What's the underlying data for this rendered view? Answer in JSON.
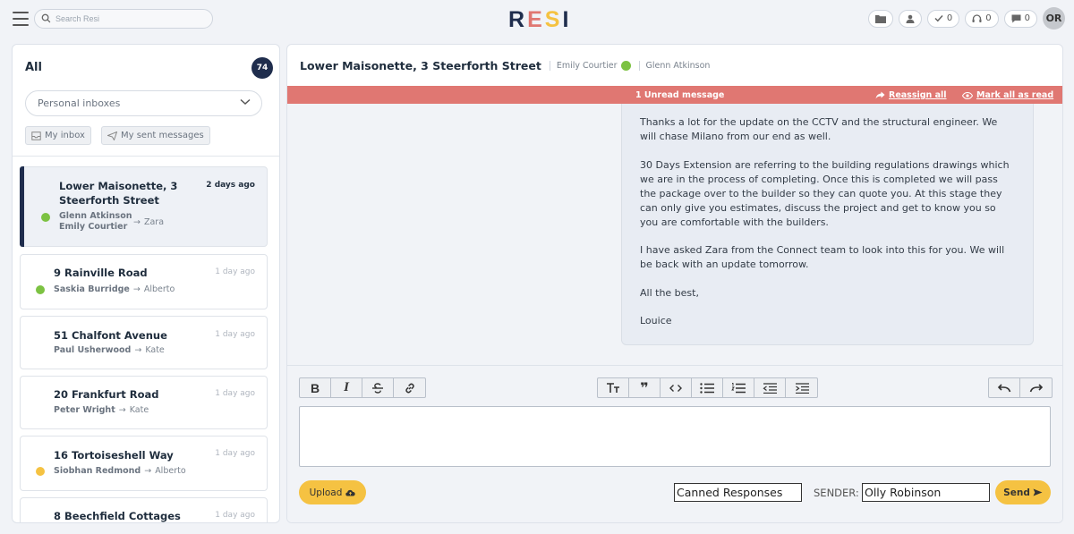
{
  "header": {
    "search_placeholder": "Search Resi",
    "logo_letters": [
      "R",
      "E",
      "S",
      "I"
    ],
    "logo_colors": [
      "#1f2d4d",
      "#e07772",
      "#f5c242",
      "#1f2d4d"
    ],
    "tasks_count": "0",
    "support_count": "0",
    "messages_count": "0",
    "avatar_initials": "OR"
  },
  "sidebar": {
    "title": "All",
    "count": "74",
    "inbox_select": "Personal inboxes",
    "my_inbox": "My inbox",
    "my_sent": "My sent messages",
    "conversations": [
      {
        "title_line1": "Lower Maisonette, 3",
        "title_line2": "Steerforth Street",
        "time": "2 days ago",
        "from1": "Glenn Atkinson",
        "from2": "Emily Courtier",
        "to": "Zara",
        "mood": "green"
      },
      {
        "title": "9 Rainville Road",
        "time": "1 day ago",
        "from": "Saskia Burridge",
        "to": "Alberto",
        "mood": "green"
      },
      {
        "title": "51 Chalfont Avenue",
        "time": "1 day ago",
        "from": "Paul Usherwood",
        "to": "Kate",
        "mood": ""
      },
      {
        "title": "20 Frankfurt Road",
        "time": "1 day ago",
        "from": "Peter Wright",
        "to": "Kate",
        "mood": ""
      },
      {
        "title": "16 Tortoiseshell Way",
        "time": "1 day ago",
        "from": "Siobhan Redmond",
        "to": "Alberto",
        "mood": "yellow"
      },
      {
        "title": "8 Beechfield Cottages",
        "time": "1 day ago"
      }
    ]
  },
  "conversation": {
    "title": "Lower Maisonette, 3 Steerforth Street",
    "participant1": "Emily Courtier",
    "participant2": "Glenn Atkinson",
    "unread_text": "1 Unread message",
    "reassign_label": "Reassign all",
    "mark_read_label": "Mark all as read",
    "message_paragraphs": [
      "Thanks a lot for the update on the CCTV and the structural engineer. We will chase Milano from our end as well.",
      "30 Days Extension are referring to the building regulations drawings which we are in the process of completing. Once this is completed we will pass the package over to the builder so they can quote you. At this stage they can only give you estimates, discuss the project and get to know you so you are comfortable with the builders.",
      "I have asked Zara from the Connect team to look into this for you. We will be back with an update tomorrow.",
      "All the best,",
      "Louice"
    ]
  },
  "composer": {
    "upload_label": "Upload",
    "canned_label": "Canned Responses",
    "sender_label": "SENDER:",
    "sender_value": "Olly Robinson",
    "send_label": "Send"
  },
  "colors": {
    "navy": "#1f2d4d",
    "unread_bar": "#e07772",
    "accent_yellow": "#f5c242",
    "mood_green": "#7cc242",
    "mood_yellow": "#f5c242"
  }
}
